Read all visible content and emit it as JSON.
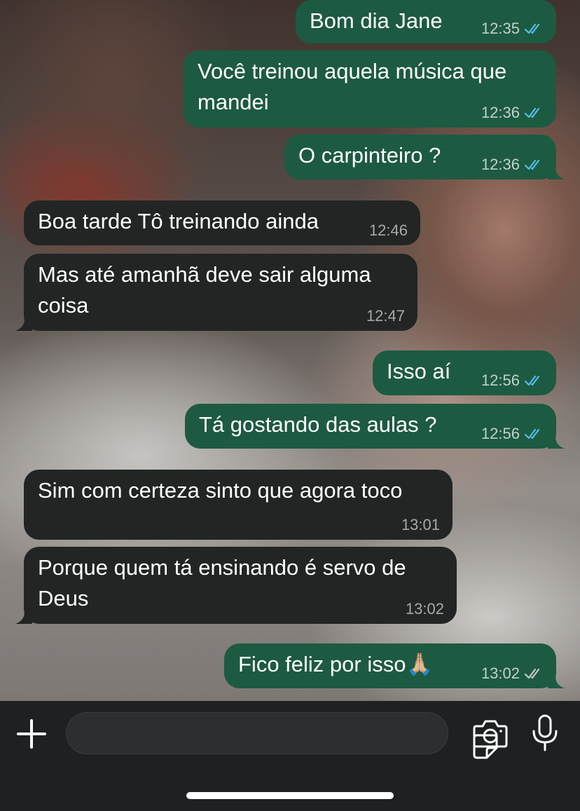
{
  "messages": [
    {
      "direction": "out",
      "text": "Bom dia Jane",
      "time": "12:35",
      "status": "read"
    },
    {
      "direction": "out",
      "text": "Você treinou aquela música que mandei",
      "time": "12:36",
      "status": "read"
    },
    {
      "direction": "out",
      "text": "O carpinteiro ?",
      "time": "12:36",
      "status": "read"
    },
    {
      "direction": "in",
      "text": "Boa tarde Tô treinando ainda",
      "time": "12:46"
    },
    {
      "direction": "in",
      "text": "Mas até amanhã deve sair alguma coisa",
      "time": "12:47"
    },
    {
      "direction": "out",
      "text": "Isso aí",
      "time": "12:56",
      "status": "read"
    },
    {
      "direction": "out",
      "text": "Tá gostando das aulas ?",
      "time": "12:56",
      "status": "read"
    },
    {
      "direction": "in",
      "text": "Sim com certeza sinto que agora toco",
      "time": "13:01"
    },
    {
      "direction": "in",
      "text": "Porque quem tá ensinando é servo de Deus",
      "time": "13:02"
    },
    {
      "direction": "out",
      "text": "Fico feliz por isso🙏🏼",
      "time": "13:02",
      "status": "delivered"
    }
  ],
  "composer": {
    "placeholder": "",
    "icons": [
      "plus-icon",
      "sticker-icon",
      "camera-icon",
      "microphone-icon"
    ]
  },
  "colors": {
    "outgoing_bubble": "#1d5a42",
    "incoming_bubble": "#222524",
    "read_tick": "#53bdeb",
    "delivered_tick": "#c8c8c8",
    "composer_bg": "#1f2021"
  }
}
